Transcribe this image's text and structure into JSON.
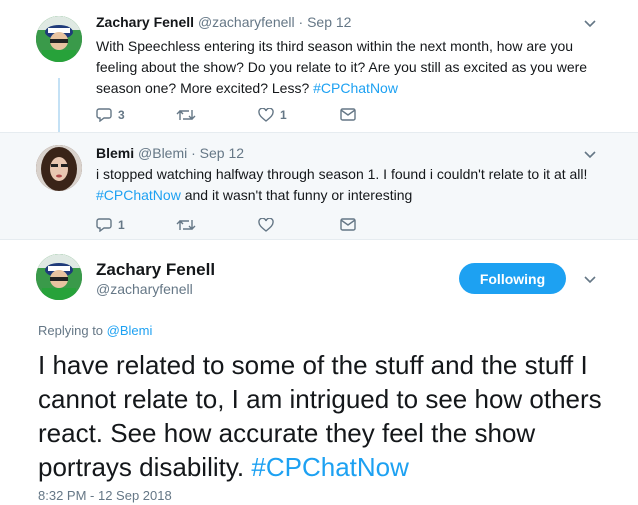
{
  "tweets": [
    {
      "author_name": "Zachary Fenell",
      "author_handle": "@zacharyfenell",
      "date": "· Sep 12",
      "text": "With Speechless entering its third season within the next month, how are you feeling about the show? Do you relate to it? Are you still as excited as you were season one? More excited? Less?",
      "hashtag": "#CPChatNow",
      "replies": "3",
      "retweets": "",
      "likes": "1"
    },
    {
      "author_name": "Blemi",
      "author_handle": "@Blemi",
      "date": "· Sep 12",
      "text": "i stopped watching halfway through season 1. I found i couldn't relate to it at all!",
      "hashtag": "#CPChatNow",
      "text_after": " and it wasn't that funny or interesting",
      "replies": "1",
      "retweets": "",
      "likes": ""
    }
  ],
  "main_tweet": {
    "author_name": "Zachary Fenell",
    "author_handle": "@zacharyfenell",
    "follow_label": "Following",
    "replying_prefix": "Replying to ",
    "replying_to": "@Blemi",
    "text": "I have related to some of the stuff and the stuff I cannot relate to, I am intrigued to see how others react. See how accurate they feel the show portrays disability.",
    "hashtag": "#CPChatNow",
    "timestamp": "8:32 PM - 12 Sep 2018"
  },
  "colors": {
    "accent": "#1da1f2",
    "muted": "#657786",
    "text": "#14171a",
    "reply_bg": "#f5f8fa"
  },
  "icons": [
    "reply-icon",
    "retweet-icon",
    "like-icon",
    "message-icon",
    "chevron-down-icon"
  ]
}
